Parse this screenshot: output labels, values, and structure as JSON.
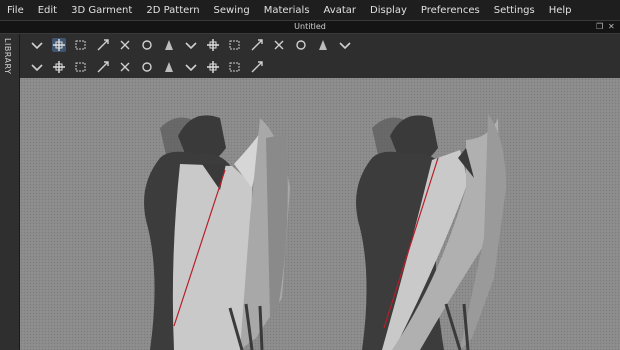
{
  "menu": [
    "File",
    "Edit",
    "3D Garment",
    "2D Pattern",
    "Sewing",
    "Materials",
    "Avatar",
    "Display",
    "Preferences",
    "Settings",
    "Help"
  ],
  "window": {
    "title": "Untitled"
  },
  "sidebar": {
    "label": "LIBRARY"
  },
  "toolbar_row1": [
    {
      "icon": "select-mesh-icon",
      "active": false
    },
    {
      "icon": "select-move-icon",
      "active": true
    },
    {
      "icon": "select-box-icon",
      "active": false
    },
    {
      "icon": "transform-pattern-icon",
      "active": false
    },
    {
      "icon": "fold-arrangement-icon",
      "active": false
    },
    {
      "icon": "fold-tool-icon",
      "active": false
    },
    {
      "icon": "tack-icon",
      "active": false
    },
    {
      "icon": "pin-icon",
      "active": false
    },
    {
      "icon": "sew-icon",
      "active": false
    },
    {
      "icon": "steam-icon",
      "active": false
    },
    {
      "icon": "avatar-pose-icon",
      "active": false
    },
    {
      "icon": "garment-fit-icon",
      "active": false
    },
    {
      "icon": "layer-icon",
      "active": false
    },
    {
      "icon": "measure-icon",
      "active": false
    },
    {
      "icon": "ruler-icon",
      "active": false
    }
  ],
  "toolbar_row2": [
    {
      "icon": "texture-checker-icon",
      "active": false
    },
    {
      "icon": "graphic-icon",
      "active": false
    },
    {
      "icon": "edit-point-icon",
      "active": false
    },
    {
      "icon": "internal-line-icon",
      "active": false
    },
    {
      "icon": "seam-line-icon",
      "active": false
    },
    {
      "icon": "button-icon",
      "active": false
    },
    {
      "icon": "buttonhole-icon",
      "active": false
    },
    {
      "icon": "zipper-icon",
      "active": false
    },
    {
      "icon": "trim-icon",
      "active": false
    },
    {
      "icon": "fold-line-icon",
      "active": false
    },
    {
      "icon": "check-icon",
      "active": false
    }
  ],
  "colors": {
    "accent": "#3f5570",
    "viewport": "#8e8e8e",
    "avatar": "#404040",
    "garment": "#c8c8c8",
    "seam": "#b81e2a"
  }
}
